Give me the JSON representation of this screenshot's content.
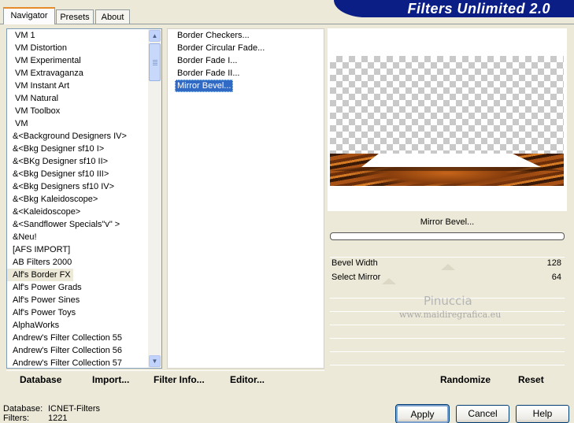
{
  "tabs": [
    {
      "label": "Navigator",
      "active": true
    },
    {
      "label": "Presets",
      "active": false
    },
    {
      "label": "About",
      "active": false
    }
  ],
  "banner": {
    "title": "Filters Unlimited 2.0"
  },
  "categories": [
    "VM 1",
    "VM Distortion",
    "VM Experimental",
    "VM Extravaganza",
    "VM Instant Art",
    "VM Natural",
    "VM Toolbox",
    "VM",
    "&<Background Designers IV>",
    "&<Bkg Designer sf10 I>",
    "&<BKg Designer sf10 II>",
    "&<Bkg Designer sf10 III>",
    "&<Bkg Designers sf10 IV>",
    "&<Bkg Kaleidoscope>",
    "&<Kaleidoscope>",
    "&<Sandflower Specials\"v\" >",
    "&Neu!",
    "[AFS IMPORT]",
    "AB Filters 2000",
    "Alf's Border FX",
    "Alf's Power Grads",
    "Alf's Power Sines",
    "Alf's Power Toys",
    "AlphaWorks",
    "Andrew's Filter Collection 55",
    "Andrew's Filter Collection 56",
    "Andrew's Filter Collection 57"
  ],
  "selected_category": "Alf's Border FX",
  "filters": [
    "Border Checkers...",
    "Border Circular Fade...",
    "Border Fade I...",
    "Border Fade II...",
    "Mirror Bevel..."
  ],
  "selected_filter": "Mirror Bevel...",
  "preview": {
    "filter_name": "Mirror Bevel..."
  },
  "params": [
    {
      "label": "Bevel Width",
      "value": "128",
      "level": 0.502
    },
    {
      "label": "Select Mirror",
      "value": "64",
      "level": 0.251
    }
  ],
  "watermark": {
    "name": "Pinuccia",
    "url": "www.maidiregrafica.eu"
  },
  "toolbar": {
    "database": "Database",
    "import": "Import...",
    "filter_info": "Filter Info...",
    "editor": "Editor...",
    "randomize": "Randomize",
    "reset": "Reset"
  },
  "status": {
    "database_label": "Database:",
    "database_value": "ICNET-Filters",
    "filters_label": "Filters:",
    "filters_value": "1221"
  },
  "buttons": {
    "apply": "Apply",
    "cancel": "Cancel",
    "help": "Help"
  }
}
